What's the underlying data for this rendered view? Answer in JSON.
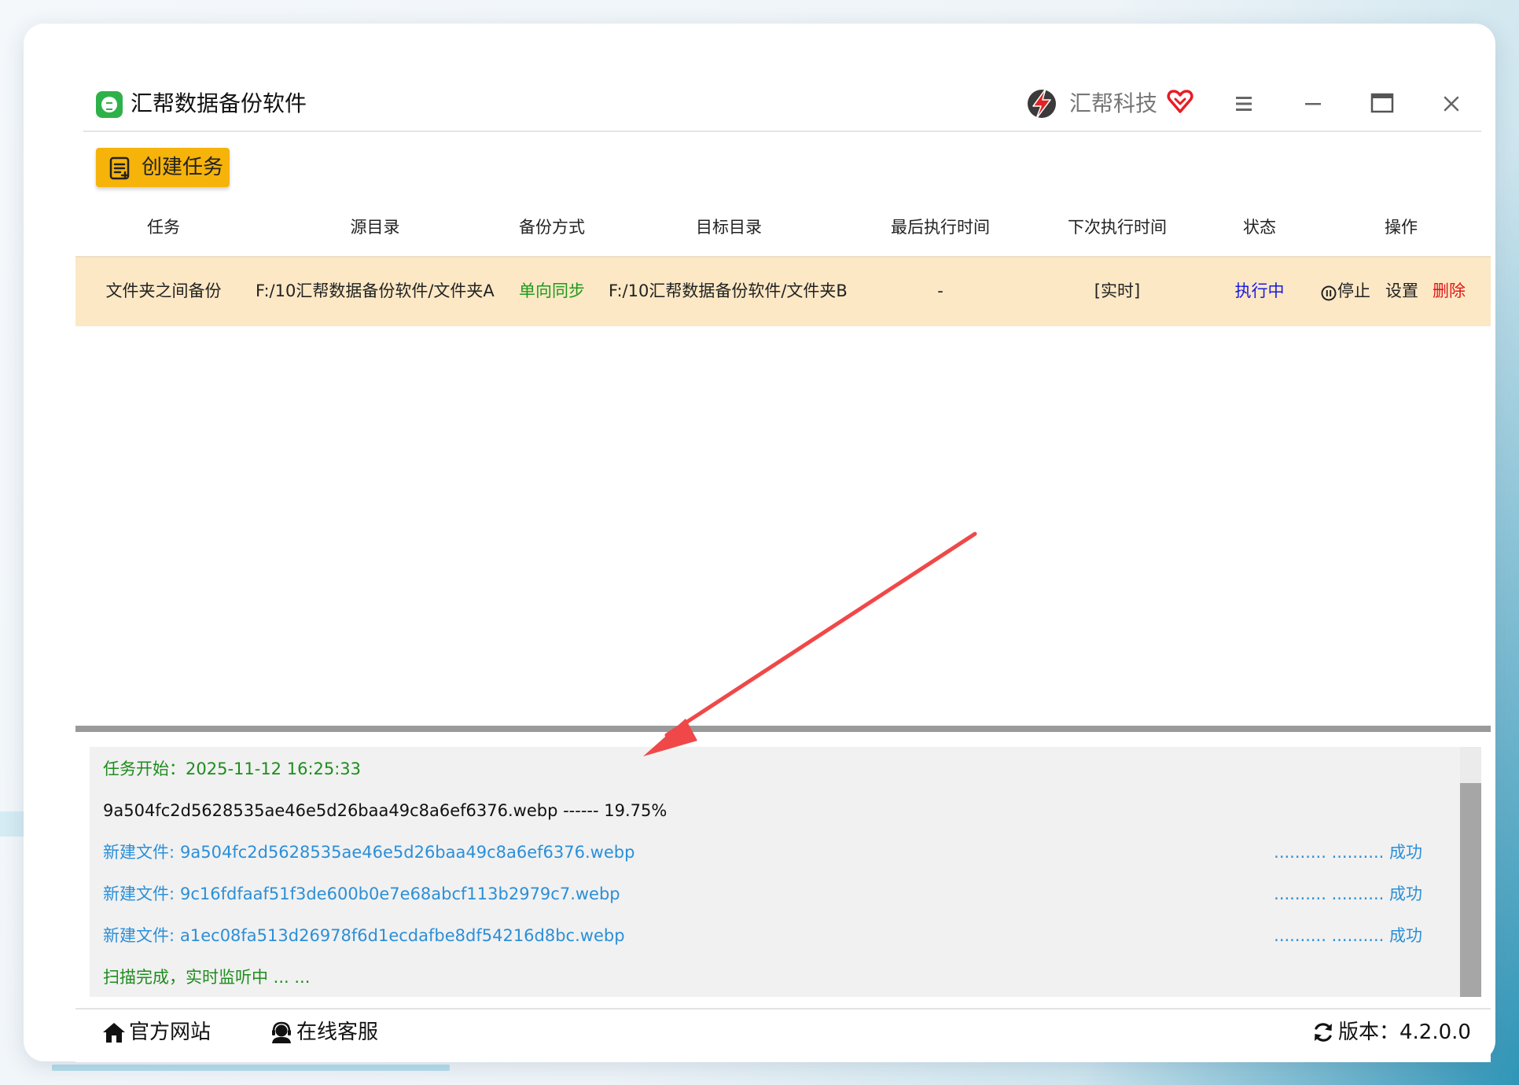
{
  "app": {
    "title": "汇帮数据备份软件",
    "brand_name": "汇帮科技"
  },
  "toolbar": {
    "create_label": "创建任务"
  },
  "table": {
    "headers": [
      "任务",
      "源目录",
      "备份方式",
      "目标目录",
      "最后执行时间",
      "下次执行时间",
      "状态",
      "操作"
    ],
    "row": {
      "task": "文件夹之间备份",
      "source": "F:/10汇帮数据备份软件/文件夹A",
      "mode": "单向同步",
      "target": "F:/10汇帮数据备份软件/文件夹B",
      "last_run": "-",
      "next_run": "[实时]",
      "status": "执行中",
      "actions": {
        "stop": "停止",
        "settings": "设置",
        "delete": "删除"
      }
    }
  },
  "log": {
    "start": "任务开始：2025-11-12 16:25:33",
    "progress": "9a504fc2d5628535ae46e5d26baa49c8a6ef6376.webp ------ 19.75%",
    "entries": [
      {
        "label": "新建文件:",
        "file": "9a504fc2d5628535ae46e5d26baa49c8a6ef6376.webp",
        "result": ".......... .......... 成功"
      },
      {
        "label": "新建文件:",
        "file": "9c16fdfaaf51f3de600b0e7e68abcf113b2979c7.webp",
        "result": ".......... .......... 成功"
      },
      {
        "label": "新建文件:",
        "file": "a1ec08fa513d26978f6d1ecdafbe8df54216d8bc.webp",
        "result": ".......... .......... 成功"
      }
    ],
    "done": "扫描完成，实时监听中 ... ..."
  },
  "footer": {
    "website": "官方网站",
    "service": "在线客服",
    "version": "版本：4.2.0.0"
  },
  "colors": {
    "accent_yellow": "#f6b30a",
    "row_highlight": "#fce8c5",
    "status_blue": "#1a1adf",
    "mode_green": "#1e9a1e",
    "delete_red": "#e01818",
    "log_blue": "#2b8fd8",
    "annotation_red": "#f04848"
  },
  "icons": [
    "app-logo-icon",
    "brand-lightning-icon",
    "heart-icon",
    "menu-icon",
    "minimize-icon",
    "maximize-icon",
    "close-icon",
    "task-list-icon",
    "pause-circle-icon",
    "home-icon",
    "headset-icon",
    "refresh-icon"
  ]
}
